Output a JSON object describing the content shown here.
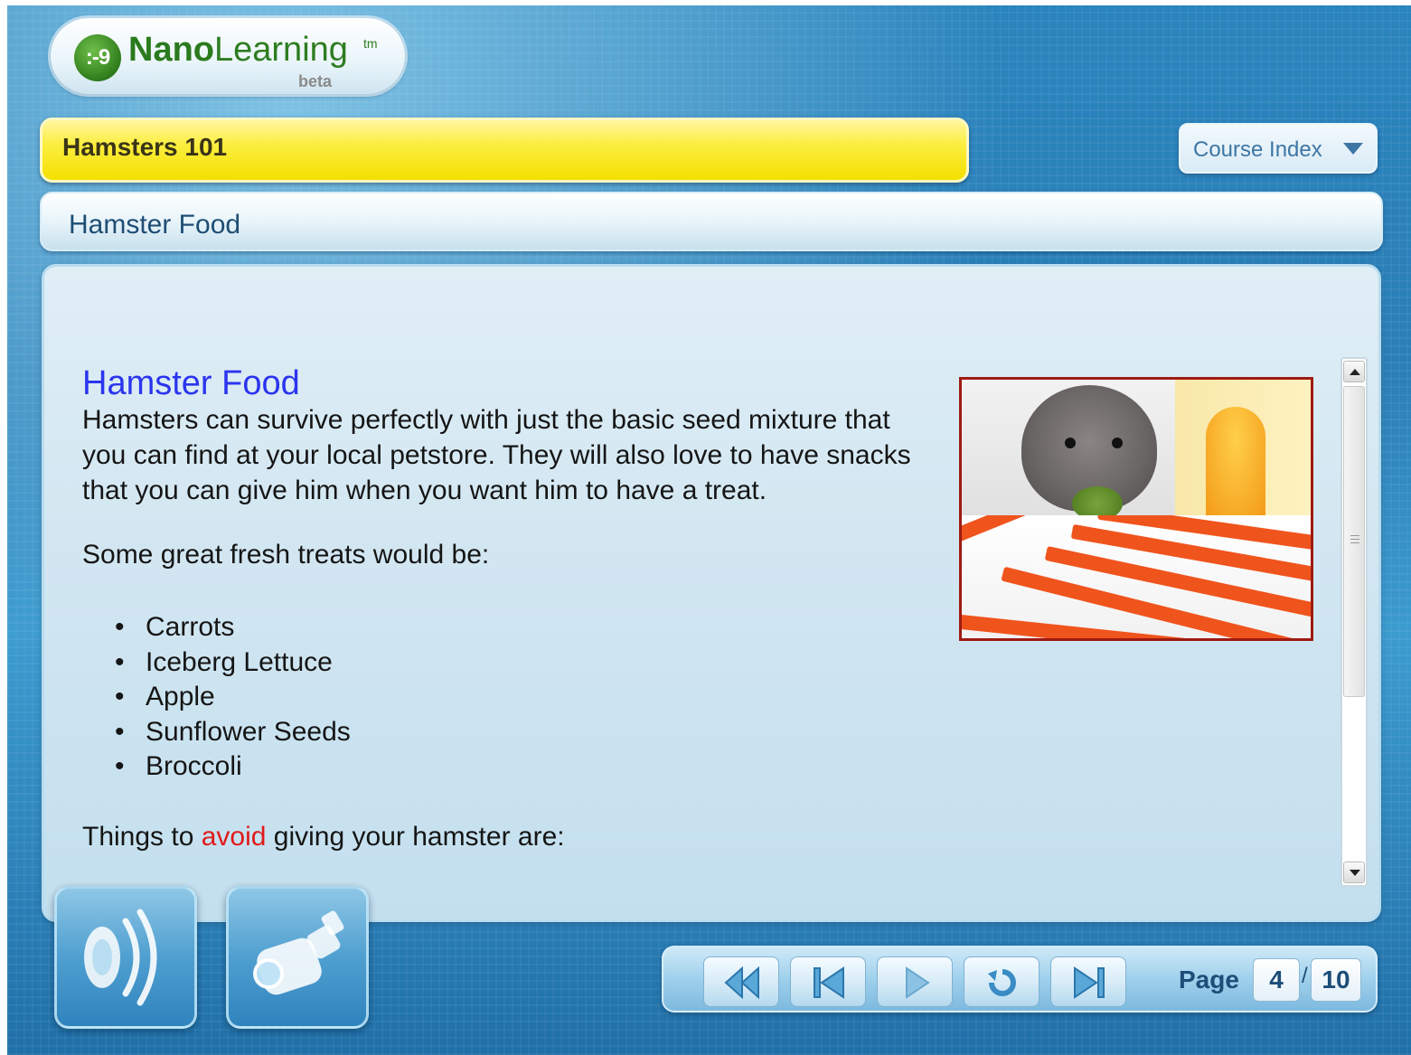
{
  "logo": {
    "mark": ":-9",
    "word_bold": "Nano",
    "word_light": "Learning",
    "tm": "tm",
    "tag": "beta"
  },
  "header": {
    "course_title": "Hamsters 101",
    "course_index_label": "Course Index"
  },
  "section": {
    "title": "Hamster Food"
  },
  "content": {
    "title": "Hamster Food",
    "paragraph": "Hamsters can survive perfectly with just the basic seed mixture that you can find at your local petstore. They will also love to have snacks that you can give him when you want him to have a treat.",
    "treats_intro": "Some great fresh treats would be:",
    "treats": [
      "Carrots",
      "Iceberg Lettuce",
      "Apple",
      "Sunflower Seeds",
      "Broccoli"
    ],
    "avoid_prefix": "Things to ",
    "avoid_word": "avoid",
    "avoid_suffix": " giving your hamster are:"
  },
  "navigation": {
    "page_label": "Page",
    "current_page": "4",
    "separator": "/",
    "total_pages": "10"
  },
  "colors": {
    "course_bar": "#f4e000",
    "title_blue": "#2b35ee",
    "avoid_red": "#e01a1a",
    "photo_border": "#9e1b12"
  },
  "icons": {
    "audio": "speaker-icon",
    "video": "camcorder-icon",
    "rewind": "rewind-icon",
    "first": "skip-back-icon",
    "play": "play-icon",
    "replay": "replay-icon",
    "next": "skip-forward-icon"
  }
}
